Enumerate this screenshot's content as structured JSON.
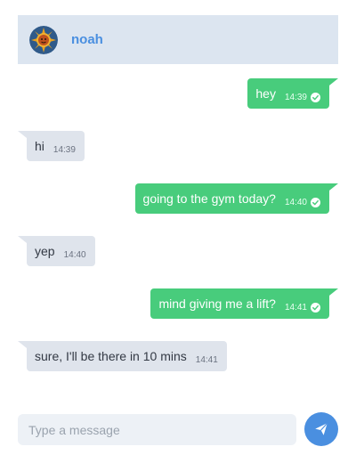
{
  "header": {
    "contact_name": "noah",
    "avatar_icon": "sun-face-avatar"
  },
  "messages": [
    {
      "direction": "out",
      "text": "hey",
      "time": "14:39",
      "status_icon": "check-circle-icon"
    },
    {
      "direction": "in",
      "text": "hi",
      "time": "14:39"
    },
    {
      "direction": "out",
      "text": "going to the gym today?",
      "time": "14:40",
      "status_icon": "check-circle-icon"
    },
    {
      "direction": "in",
      "text": "yep",
      "time": "14:40"
    },
    {
      "direction": "out",
      "text": "mind giving me a lift?",
      "time": "14:41",
      "status_icon": "check-circle-icon"
    },
    {
      "direction": "in",
      "text": "sure, I'll be there in 10 mins",
      "time": "14:41"
    }
  ],
  "composer": {
    "placeholder": "Type a message",
    "value": "",
    "send_icon": "send-icon"
  },
  "colors": {
    "header_bg": "#dce5f0",
    "accent": "#4a8fe0",
    "outgoing_bubble": "#48cc7c",
    "incoming_bubble": "#dfe4ec"
  }
}
